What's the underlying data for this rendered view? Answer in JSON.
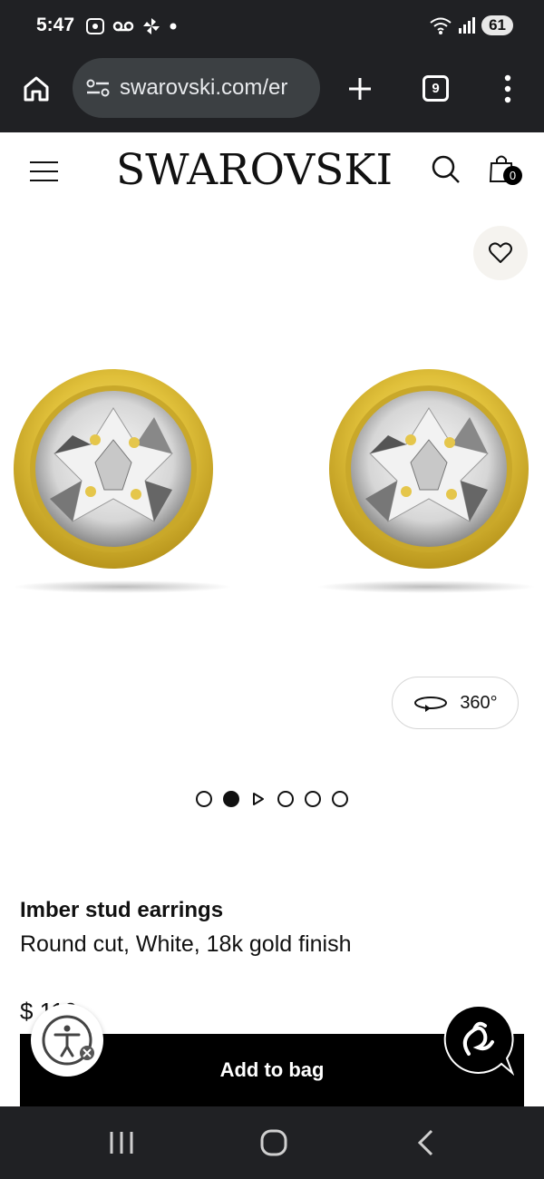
{
  "status_bar": {
    "time": "5:47",
    "battery": "61",
    "network_label": "5"
  },
  "browser": {
    "url": "swarovski.com/er",
    "tab_count": "9"
  },
  "site": {
    "brand": "SWAROVSKI",
    "cart_count": "0"
  },
  "gallery": {
    "viewer_label": "360°",
    "slide_count": 6,
    "active_slide": 2
  },
  "product": {
    "name": "Imber stud earrings",
    "description": "Round cut, White, 18k gold finish",
    "price": "$ 110"
  },
  "actions": {
    "add_to_bag": "Add to bag"
  },
  "colors": {
    "accent": "#000000",
    "gold": "#d9b524",
    "chrome": "#202124"
  }
}
